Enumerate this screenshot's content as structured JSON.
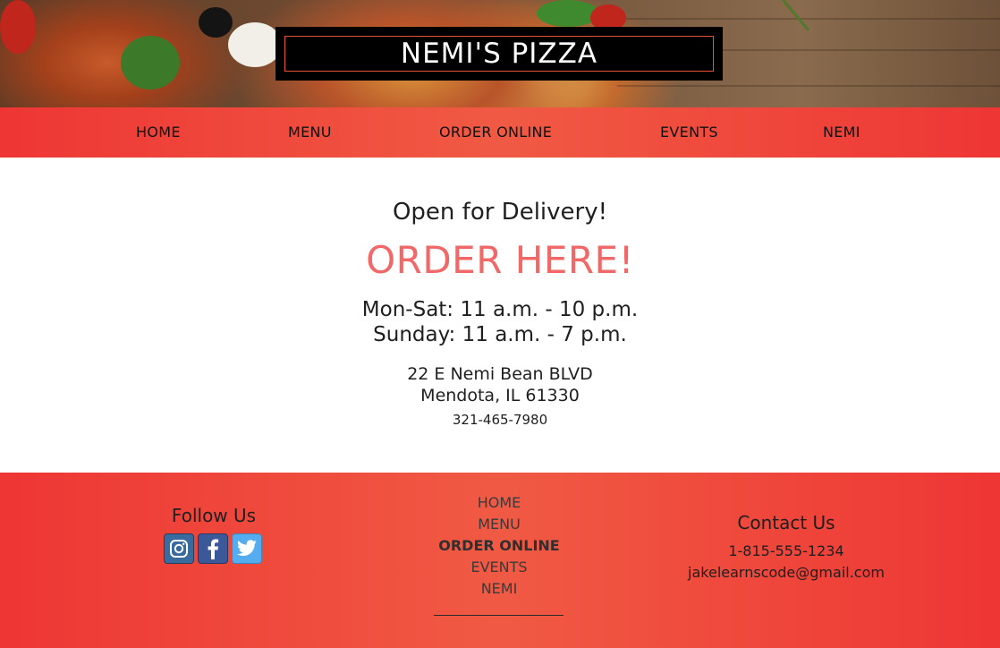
{
  "header": {
    "title": "NEMI'S PIZZA"
  },
  "nav": {
    "items": [
      {
        "label": "HOME"
      },
      {
        "label": "MENU"
      },
      {
        "label": "ORDER ONLINE"
      },
      {
        "label": "EVENTS"
      },
      {
        "label": "NEMI"
      }
    ]
  },
  "main": {
    "open_text": "Open for Delivery!",
    "order_link": "ORDER HERE!",
    "hours": [
      "Mon-Sat: 11 a.m. - 10 p.m.",
      "Sunday: 11 a.m. - 7 p.m."
    ],
    "address": [
      "22 E Nemi Bean BLVD",
      "Mendota, IL 61330"
    ],
    "phone": "321-465-7980"
  },
  "footer": {
    "follow_title": "Follow Us",
    "socials": [
      {
        "icon": "instagram-icon"
      },
      {
        "icon": "facebook-icon"
      },
      {
        "icon": "twitter-icon"
      }
    ],
    "nav_items": [
      {
        "label": "HOME"
      },
      {
        "label": "MENU"
      },
      {
        "label": "ORDER ONLINE",
        "active": true
      },
      {
        "label": "EVENTS"
      },
      {
        "label": "NEMI"
      }
    ],
    "contact_title": "Contact Us",
    "contact_phone": "1-815-555-1234",
    "contact_email": "jakelearnscode@gmail.com"
  },
  "colors": {
    "accent_red": "#ee3634",
    "accent_coral": "#f05a44",
    "order_link": "#f06868"
  }
}
